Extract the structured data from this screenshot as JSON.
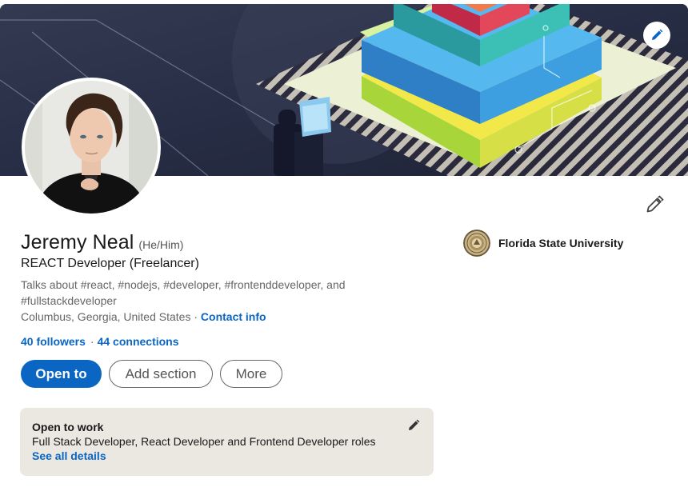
{
  "profile": {
    "name": "Jeremy Neal",
    "pronouns": "(He/Him)",
    "headline": "REACT Developer (Freelancer)",
    "talks_about": "Talks about #react, #nodejs, #developer, #frontenddeveloper, and #fullstackdeveloper",
    "location": "Columbus, Georgia, United States",
    "location_separator": " · ",
    "contact_info_label": "Contact info",
    "followers_label": "40 followers",
    "followers_separator": "·",
    "connections_label": "44 connections"
  },
  "actions": {
    "open_to_label": "Open to",
    "add_section_label": "Add section",
    "more_label": "More"
  },
  "education": {
    "school": "Florida State University"
  },
  "open_to_work": {
    "title": "Open to work",
    "roles": "Full Stack Developer, React Developer and Frontend Developer roles",
    "details_link": "See all details"
  },
  "icons": {
    "banner_edit": "pencil-icon",
    "profile_edit": "pencil-icon",
    "open_to_work_edit": "pencil-icon"
  },
  "colors": {
    "accent": "#0a66c2",
    "open_to_work_bg": "#ebe7e1"
  }
}
